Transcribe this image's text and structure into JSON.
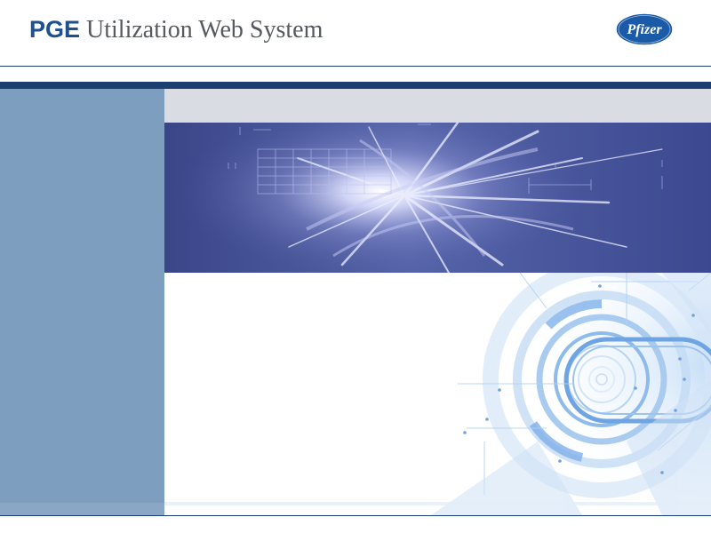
{
  "header": {
    "title_bold": "PGE",
    "title_rest": " Utilization Web System",
    "logo_text": "Pfizer"
  },
  "colors": {
    "brand_blue": "#1e4f8f",
    "rule_navy": "#1c3f72",
    "sidebar": "#7d9ebf",
    "topbar": "#d9dde3",
    "banner_bg": "#3d4a8e"
  },
  "images": {
    "banner": "abstract-light-burst",
    "content_art": "concentric-tech-circles"
  }
}
